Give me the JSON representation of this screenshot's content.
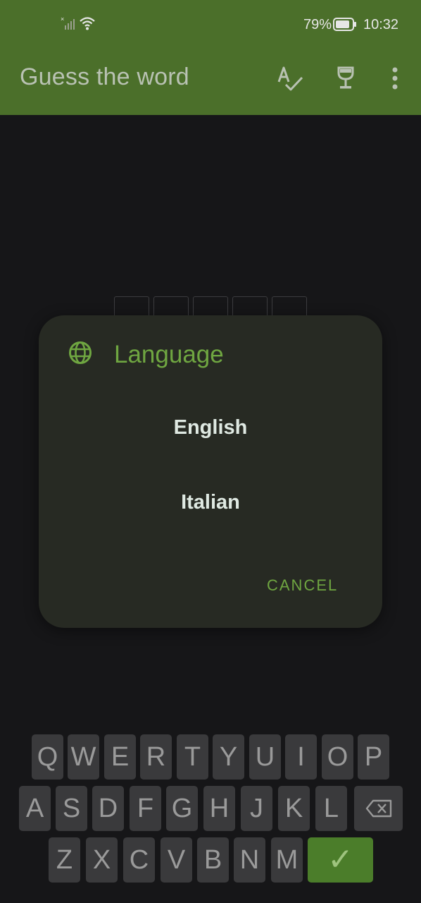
{
  "status_bar": {
    "battery_percent": "79%",
    "time": "10:32"
  },
  "app_bar": {
    "title": "Guess the word",
    "actions": [
      "spellcheck-icon",
      "trophy-icon",
      "more-vert-icon"
    ]
  },
  "word_boxes": 5,
  "dialog": {
    "icon": "globe-icon",
    "title": "Language",
    "options": [
      "English",
      "Italian"
    ],
    "cancel_label": "CANCEL"
  },
  "keyboard": {
    "rows": [
      [
        "Q",
        "W",
        "E",
        "R",
        "T",
        "Y",
        "U",
        "I",
        "O",
        "P"
      ],
      [
        "A",
        "S",
        "D",
        "F",
        "G",
        "H",
        "J",
        "K",
        "L"
      ],
      [
        "Z",
        "X",
        "C",
        "V",
        "B",
        "N",
        "M"
      ]
    ],
    "backspace": "backspace-icon",
    "enter_label": "✓"
  },
  "colors": {
    "appbar": "#4b6f2a",
    "accent": "#6fa641",
    "background": "#161618",
    "dialog": "#272a23",
    "enter_key": "#4b7d2a"
  }
}
